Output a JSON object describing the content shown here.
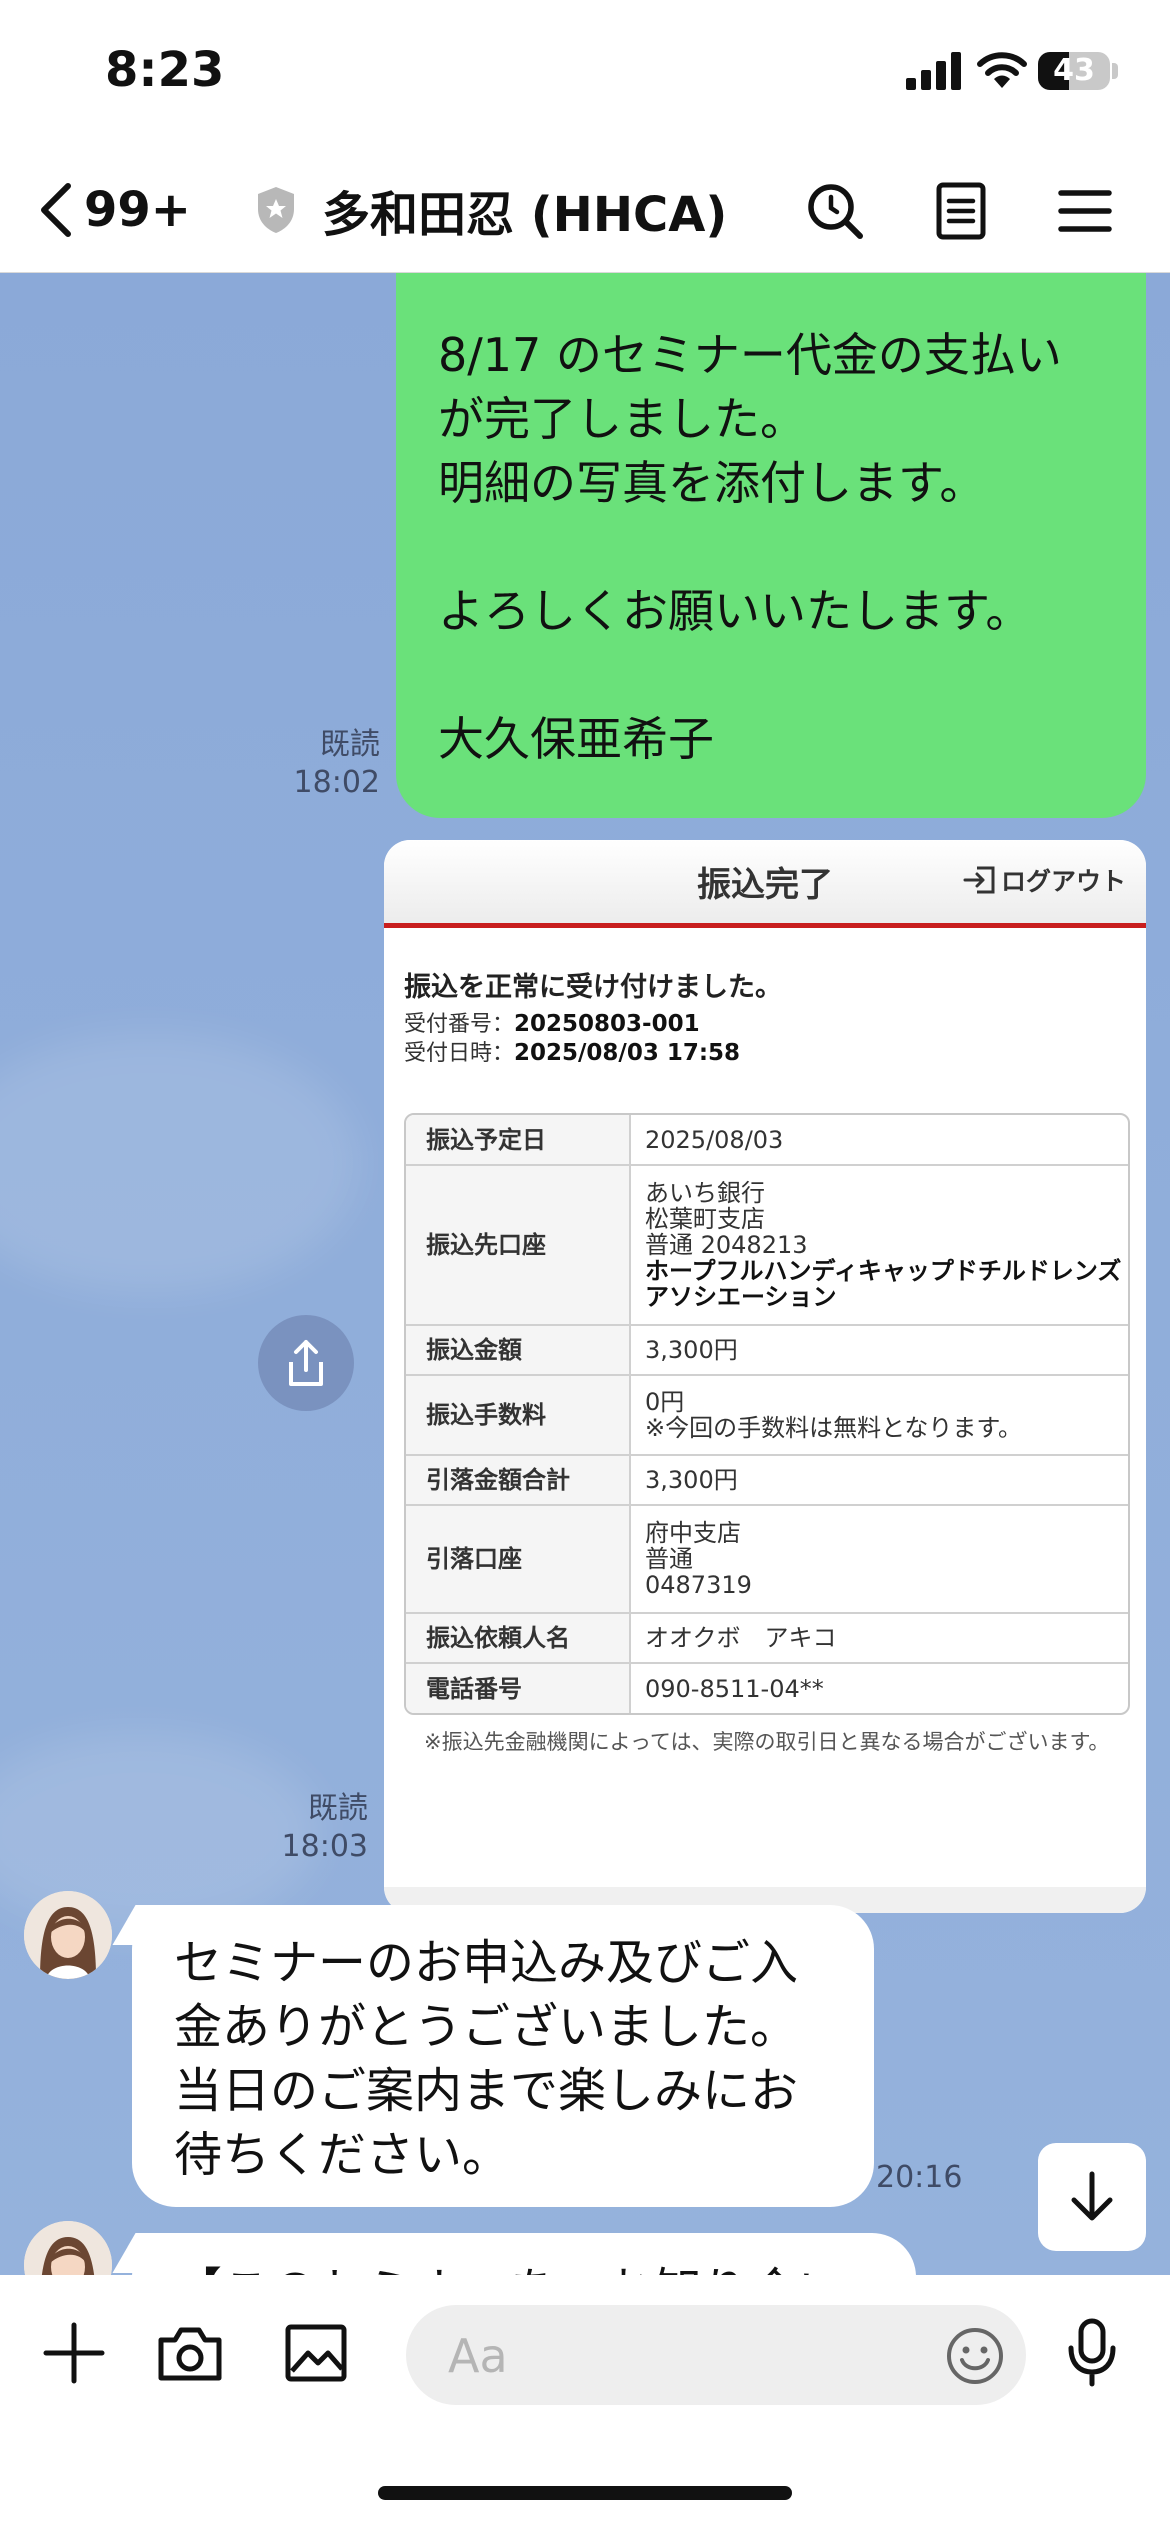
{
  "status_bar": {
    "time": "8:23",
    "battery_text": "43",
    "battery_level": 0.43
  },
  "header": {
    "back_count": "99+",
    "chat_title": "多和田忍 (HHCA)"
  },
  "messages": {
    "sent_text": "8/17 のセミナー代金の支払い\nが完了しました。\n明細の写真を添付します。\n\nよろしくお願いいたします。\n\n大久保亜希子",
    "sent_read": "既読",
    "sent_time": "18:02",
    "image_read": "既読",
    "image_time": "18:03",
    "reply_text": "セミナーのお申込み及びご入\n金ありがとうございました。\n当日のご案内まで楽しみにお\n待ちください。",
    "reply_time": "20:16",
    "next_text_partial": "【このセミナーを、お知り合い"
  },
  "receipt": {
    "title": "振込完了",
    "logout": "ログアウト",
    "success": "振込を正常に受け付けました。",
    "receipt_no_label": "受付番号：",
    "receipt_no": "20250803-001",
    "receipt_dt_label": "受付日時：",
    "receipt_dt": "2025/08/03 17:58",
    "rows": [
      {
        "label": "振込予定日",
        "lines": [
          "2025/08/03"
        ]
      },
      {
        "label": "振込先口座",
        "lines": [
          "あいち銀行",
          "松葉町支店",
          "普通 2048213"
        ],
        "strong": "ホープフルハンディキャップドチルドレンズアソシエーション"
      },
      {
        "label": "振込金額",
        "lines": [
          "3,300円"
        ]
      },
      {
        "label": "振込手数料",
        "lines": [
          "0円",
          "※今回の手数料は無料となります。"
        ]
      },
      {
        "label": "引落金額合計",
        "lines": [
          "3,300円"
        ]
      },
      {
        "label": "引落口座",
        "lines": [
          "府中支店",
          "普通",
          "0487319"
        ]
      },
      {
        "label": "振込依頼人名",
        "lines": [
          "オオクボ　アキコ"
        ]
      },
      {
        "label": "電話番号",
        "lines": [
          "090-8511-04**"
        ]
      }
    ],
    "note": "※振込先金融機関によっては、実際の取引日と異なる場合がございます。"
  },
  "input": {
    "placeholder": "Aa"
  },
  "colors": {
    "sent_bubble": "#6ae17a",
    "chat_bg": "#8fadda",
    "receipt_accent": "#c81e1e"
  }
}
